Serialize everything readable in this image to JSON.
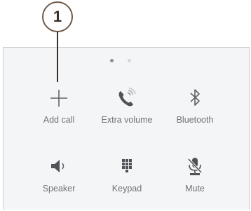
{
  "callout": {
    "number": "1"
  },
  "pager": {
    "pages": 2,
    "active_index": 0
  },
  "buttons": [
    {
      "label": "Add call",
      "icon": "plus-icon"
    },
    {
      "label": "Extra volume",
      "icon": "phone-volume-icon"
    },
    {
      "label": "Bluetooth",
      "icon": "bluetooth-icon"
    },
    {
      "label": "Speaker",
      "icon": "speaker-icon"
    },
    {
      "label": "Keypad",
      "icon": "keypad-icon"
    },
    {
      "label": "Mute",
      "icon": "mic-off-icon"
    }
  ],
  "colors": {
    "panel_bg": "#f4f5f6",
    "icon": "#5f6368",
    "label": "#6f7378",
    "callout_border": "#6d5a4a"
  }
}
